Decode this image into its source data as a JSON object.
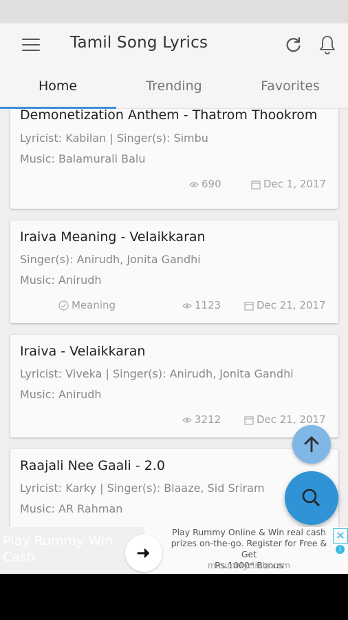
{
  "app": {
    "title": "Tamil Song Lyrics"
  },
  "tabs": [
    {
      "label": "Home",
      "active": true
    },
    {
      "label": "Trending",
      "active": false
    },
    {
      "label": "Favorites",
      "active": false
    }
  ],
  "songs": [
    {
      "title": "Demonetization Anthem - Thatrom Thookrom",
      "line1": "Lyricist: Kabilan | Singer(s): Simbu",
      "line2": "Music: Balamurali Balu",
      "meaning": "",
      "views": "690",
      "date": "Dec 1, 2017"
    },
    {
      "title": "Iraiva Meaning - Velaikkaran",
      "line1": "Singer(s): Anirudh, Jonita Gandhi",
      "line2": "Music: Anirudh",
      "meaning": "Meaning",
      "views": "1123",
      "date": "Dec 21, 2017"
    },
    {
      "title": "Iraiva - Velaikkaran",
      "line1": "Lyricist: Viveka | Singer(s): Anirudh, Jonita Gandhi",
      "line2": "Music: Anirudh",
      "meaning": "",
      "views": "3212",
      "date": "Dec 21, 2017"
    },
    {
      "title": "Raajali Nee Gaali - 2.0",
      "line1": "Lyricist: Karky | Singer(s): Blaaze, Sid Sriram",
      "line2": "Music: AR Rahman",
      "meaning": "",
      "views": "",
      "date": ""
    }
  ],
  "ad": {
    "left_text": "Play Rummy Win Cash",
    "text_line1": "Play Rummy Online & Win real cash",
    "text_line2": "prizes on-the-go. Register for Free & Get",
    "text_line3": "Rs.1000* Bonus",
    "url": "m.rummycircle.com",
    "close": "✕",
    "info": "i"
  },
  "colors": {
    "accent": "#3f8ed8",
    "fab_search": "#2f93d6",
    "fab_up": "#7fb8e6"
  },
  "icons": [
    "menu-icon",
    "refresh-icon",
    "bell-icon",
    "eye-icon",
    "calendar-icon",
    "check-circle-icon",
    "arrow-up-icon",
    "search-icon",
    "arrow-right-icon"
  ]
}
